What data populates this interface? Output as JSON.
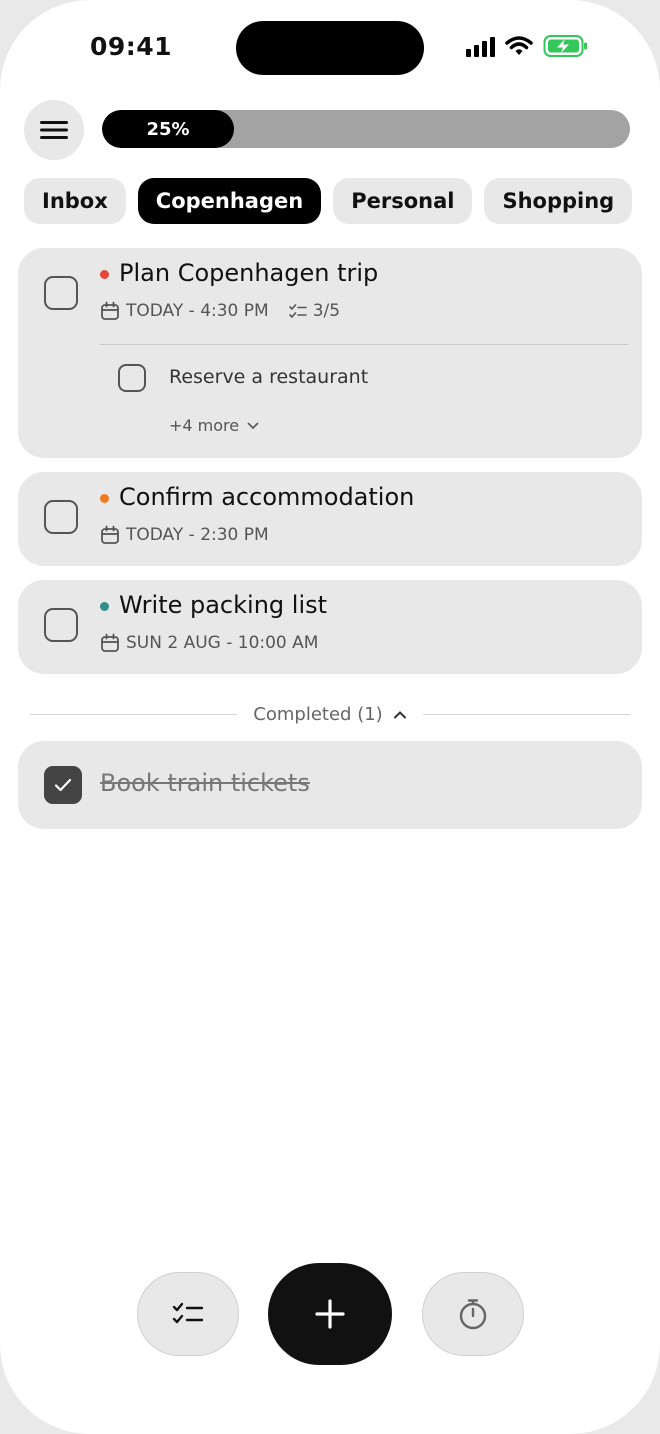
{
  "status_bar": {
    "time": "09:41"
  },
  "progress": {
    "label": "25%",
    "value": 0.25
  },
  "tabs": [
    {
      "label": "Inbox",
      "active": false
    },
    {
      "label": "Copenhagen",
      "active": true
    },
    {
      "label": "Personal",
      "active": false
    },
    {
      "label": "Shopping",
      "active": false
    }
  ],
  "tasks": [
    {
      "title": "Plan Copenhagen trip",
      "priority_color": "#e8453c",
      "due": "TODAY - 4:30 PM",
      "subtask_count": "3/5",
      "subtask": {
        "title": "Reserve a restaurant"
      },
      "more_label": "+4 more"
    },
    {
      "title": "Confirm accommodation",
      "priority_color": "#f07a1f",
      "due": "TODAY - 2:30 PM"
    },
    {
      "title": "Write packing list",
      "priority_color": "#2f8f86",
      "due": "SUN 2 AUG - 10:00 AM"
    }
  ],
  "completed": {
    "label": "Completed (1)",
    "items": [
      {
        "title": "Book train tickets"
      }
    ]
  },
  "icons": {
    "menu": "hamburger-menu-icon",
    "calendar": "calendar-icon",
    "checklist": "checklist-icon",
    "add": "plus-icon",
    "timer": "stopwatch-icon"
  }
}
